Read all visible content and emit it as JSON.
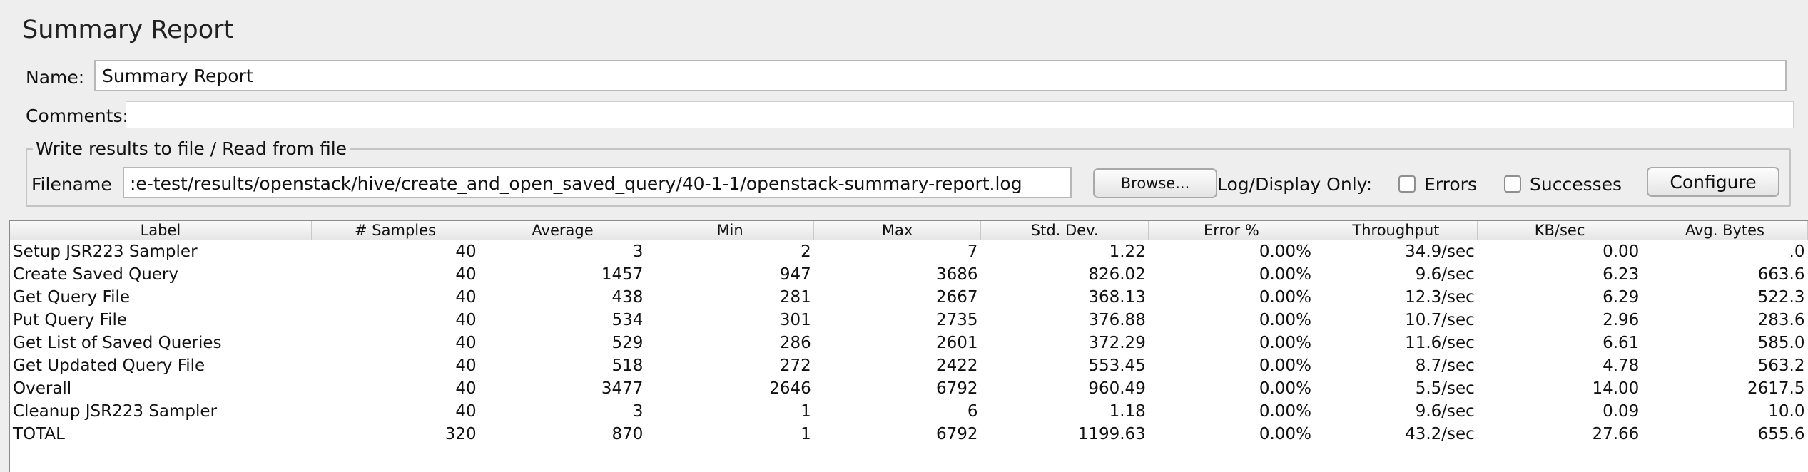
{
  "title": "Summary Report",
  "name": {
    "label": "Name:",
    "value": "Summary Report"
  },
  "comments": {
    "label": "Comments:",
    "value": ""
  },
  "file_section": {
    "legend": "Write results to file / Read from file",
    "filename_label": "Filename",
    "filename_value": ":e-test/results/openstack/hive/create_and_open_saved_query/40-1-1/openstack-summary-report.log",
    "browse_label": "Browse...",
    "log_display_label": "Log/Display Only:",
    "errors_label": "Errors",
    "errors_checked": false,
    "successes_label": "Successes",
    "successes_checked": false,
    "configure_label": "Configure"
  },
  "table": {
    "columns": [
      "Label",
      "# Samples",
      "Average",
      "Min",
      "Max",
      "Std. Dev.",
      "Error %",
      "Throughput",
      "KB/sec",
      "Avg. Bytes"
    ],
    "rows": [
      [
        "Setup JSR223 Sampler",
        "40",
        "3",
        "2",
        "7",
        "1.22",
        "0.00%",
        "34.9/sec",
        "0.00",
        ".0"
      ],
      [
        "Create Saved Query",
        "40",
        "1457",
        "947",
        "3686",
        "826.02",
        "0.00%",
        "9.6/sec",
        "6.23",
        "663.6"
      ],
      [
        "Get Query File",
        "40",
        "438",
        "281",
        "2667",
        "368.13",
        "0.00%",
        "12.3/sec",
        "6.29",
        "522.3"
      ],
      [
        "Put Query File",
        "40",
        "534",
        "301",
        "2735",
        "376.88",
        "0.00%",
        "10.7/sec",
        "2.96",
        "283.6"
      ],
      [
        "Get List of Saved Queries",
        "40",
        "529",
        "286",
        "2601",
        "372.29",
        "0.00%",
        "11.6/sec",
        "6.61",
        "585.0"
      ],
      [
        "Get Updated Query File",
        "40",
        "518",
        "272",
        "2422",
        "553.45",
        "0.00%",
        "8.7/sec",
        "4.78",
        "563.2"
      ],
      [
        "Overall",
        "40",
        "3477",
        "2646",
        "6792",
        "960.49",
        "0.00%",
        "5.5/sec",
        "14.00",
        "2617.5"
      ],
      [
        "Cleanup JSR223 Sampler",
        "40",
        "3",
        "1",
        "6",
        "1.18",
        "0.00%",
        "9.6/sec",
        "0.09",
        "10.0"
      ],
      [
        "TOTAL",
        "320",
        "870",
        "1",
        "6792",
        "1199.63",
        "0.00%",
        "43.2/sec",
        "27.66",
        "655.6"
      ]
    ]
  }
}
